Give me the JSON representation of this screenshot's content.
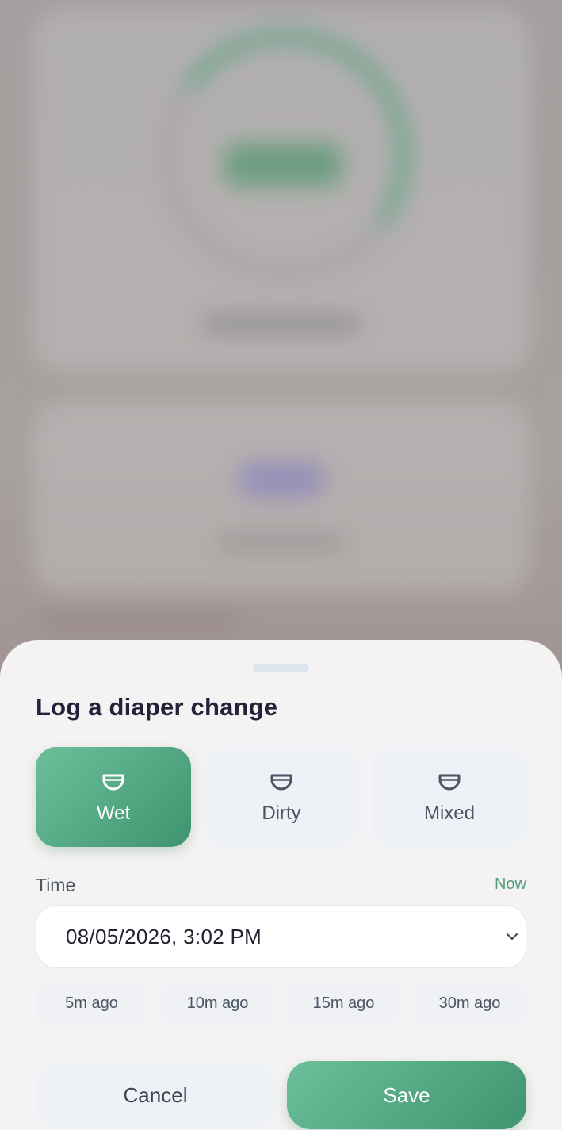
{
  "sheet": {
    "title": "Log a diaper change",
    "types": [
      {
        "label": "Wet",
        "icon": "diaper-icon",
        "selected": true
      },
      {
        "label": "Dirty",
        "icon": "diaper-icon",
        "selected": false
      },
      {
        "label": "Mixed",
        "icon": "diaper-icon",
        "selected": false
      }
    ],
    "time": {
      "label": "Time",
      "now_label": "Now",
      "value": "08/05/2026, 3:02 PM"
    },
    "quick_times": [
      "5m ago",
      "10m ago",
      "15m ago",
      "30m ago"
    ],
    "cancel_label": "Cancel",
    "save_label": "Save"
  },
  "colors": {
    "accent": "#4f9d7c",
    "accent_gradient_start": "#6cbf9a",
    "accent_gradient_end": "#3f9470",
    "sheet_background": "#f4f2f2",
    "chip_background": "#eef1f6",
    "title_text": "#22223a"
  }
}
